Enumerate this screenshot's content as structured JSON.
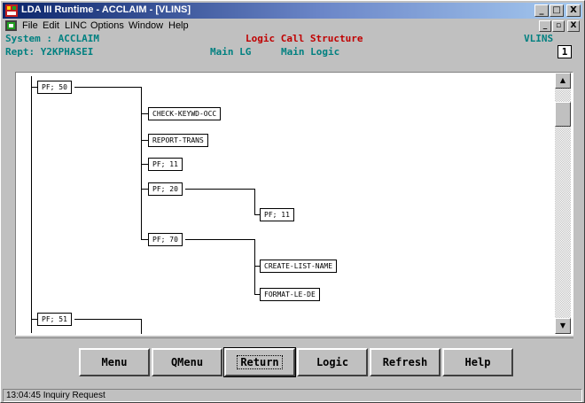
{
  "window": {
    "title": "LDA III Runtime - ACCLAIM - [VLINS]",
    "controls": [
      "_",
      "□",
      "X"
    ],
    "mdi_controls": [
      "_",
      "▫",
      "X"
    ]
  },
  "menu": [
    {
      "label": "File"
    },
    {
      "label": "Edit"
    },
    {
      "label": "LINC"
    },
    {
      "label": "Options"
    },
    {
      "label": "Window"
    },
    {
      "label": "Help"
    }
  ],
  "header": {
    "system": "System : ACCLAIM",
    "screen_title": "Logic Call Structure",
    "screen_id": "VLINS",
    "page": "1",
    "report": "Rept: Y2KPHASEI",
    "main_lg": "Main LG",
    "main_logic": "Main Logic"
  },
  "tree": {
    "nodes": [
      {
        "label": "PF; 50"
      },
      {
        "label": "CHECK-KEYWD-OCC"
      },
      {
        "label": "REPORT-TRANS"
      },
      {
        "label": "PF; 11"
      },
      {
        "label": "PF; 20"
      },
      {
        "label": "PF; 11"
      },
      {
        "label": "PF; 70"
      },
      {
        "label": "CREATE-LIST-NAME"
      },
      {
        "label": "FORMAT-LE-DE"
      },
      {
        "label": "PF; 51"
      }
    ]
  },
  "scrollbar": {
    "up": "▲",
    "down": "▼"
  },
  "buttons": [
    "Menu",
    "QMenu",
    "Return",
    "Logic",
    "Refresh",
    "Help"
  ],
  "status": "13:04:45 Inquiry Request",
  "colors": {
    "title_gradient_start": "#0a246a",
    "teal_text": "#008080",
    "red_text": "#c00000",
    "face": "#c0c0c0"
  }
}
